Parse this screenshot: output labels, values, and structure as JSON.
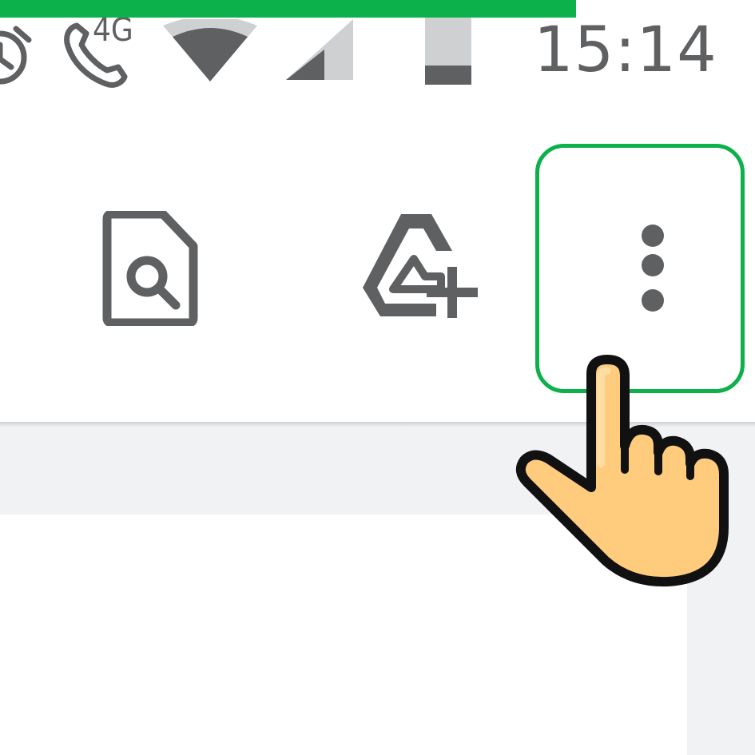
{
  "status_bar": {
    "time": "15:14",
    "network_label": "4G",
    "icons": [
      "alarm-icon",
      "phone-icon",
      "wifi-icon",
      "cell-signal-icon",
      "battery-icon"
    ]
  },
  "toolbar": {
    "actions": [
      {
        "name": "search-document-icon"
      },
      {
        "name": "add-to-drive-icon"
      },
      {
        "name": "more-options-icon"
      }
    ]
  },
  "colors": {
    "accent": "#0db14b",
    "icon": "#5f6062",
    "background": "#ffffff",
    "content_bg": "#f1f2f4",
    "hand_fill": "#ffcc7e"
  }
}
